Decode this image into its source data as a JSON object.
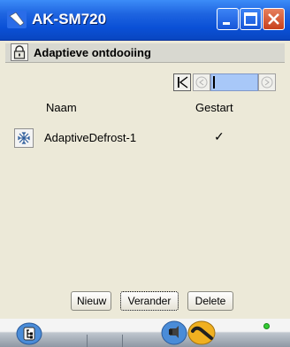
{
  "window": {
    "title": "AK-SM720"
  },
  "subtitle": {
    "text": "Adaptieve ontdooiing"
  },
  "pager": {
    "first_icon": "first-page-icon",
    "prev_icon": "prev-page-icon",
    "next_icon": "next-page-icon"
  },
  "table": {
    "headers": [
      "Naam",
      "Gestart"
    ],
    "rows": [
      {
        "name": "AdaptiveDefrost-1",
        "started": "✓"
      }
    ]
  },
  "actions": {
    "new_label": "Nieuw",
    "edit_label": "Verander",
    "delete_label": "Delete"
  },
  "colors": {
    "titlebar": "#0A50D6",
    "background": "#ECE9D8",
    "pager_track": "#A8C8F8",
    "status_led": "#33CC33"
  }
}
